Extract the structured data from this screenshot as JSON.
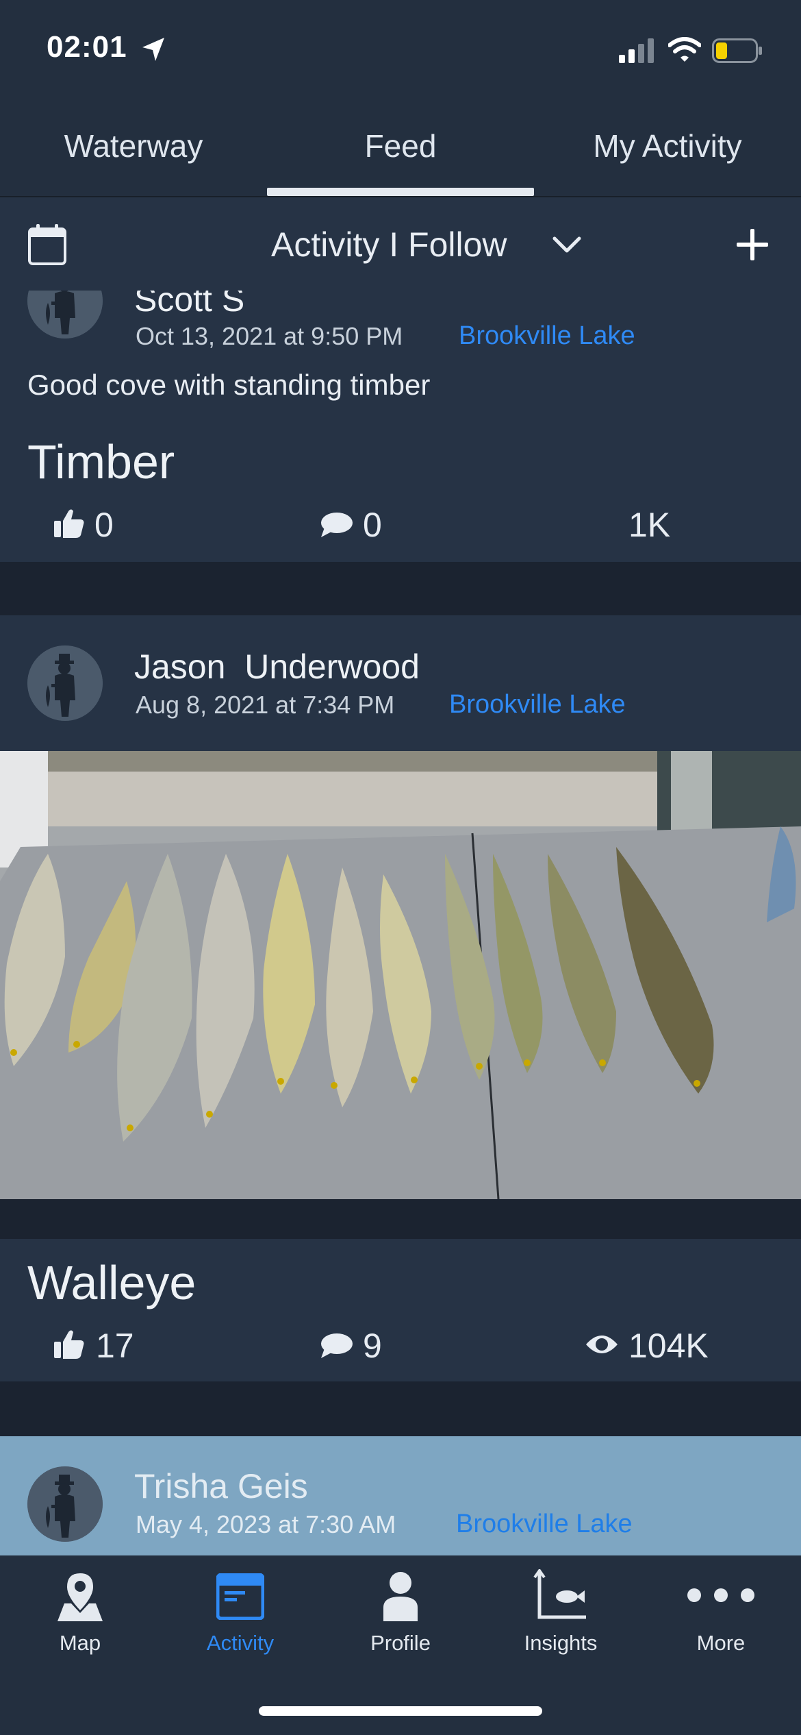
{
  "status_bar": {
    "time": "02:01"
  },
  "tabs": [
    {
      "label": "Waterway"
    },
    {
      "label": "Feed",
      "selected": true
    },
    {
      "label": "My Activity"
    }
  ],
  "filter": {
    "title": "Activity I Follow"
  },
  "posts": [
    {
      "author": "Scott S",
      "date": "Oct 13, 2021 at 9:50 PM",
      "location": "Brookville Lake",
      "caption": "Good cove with standing timber",
      "title": "Timber",
      "likes": "0",
      "comments": "0",
      "views": "1K"
    },
    {
      "author": "Jason  Underwood",
      "date": "Aug 8, 2021 at 7:34 PM",
      "location": "Brookville Lake",
      "title": "Walleye",
      "likes": "17",
      "comments": "9",
      "views": "104K"
    },
    {
      "author": "Trisha Geis",
      "date": "May 4, 2023 at 7:30 AM",
      "location": "Brookville Lake"
    }
  ],
  "bottom_nav": [
    {
      "label": "Map",
      "icon": "map-pin-icon"
    },
    {
      "label": "Activity",
      "icon": "activity-icon",
      "selected": true
    },
    {
      "label": "Profile",
      "icon": "profile-icon"
    },
    {
      "label": "Insights",
      "icon": "insights-icon"
    },
    {
      "label": "More",
      "icon": "more-icon"
    }
  ],
  "colors": {
    "background": "#1b2330",
    "card": "#263345",
    "link": "#2f8af5",
    "accent_active": "#2f8af5",
    "highlight_card": "#7ea6c2"
  }
}
